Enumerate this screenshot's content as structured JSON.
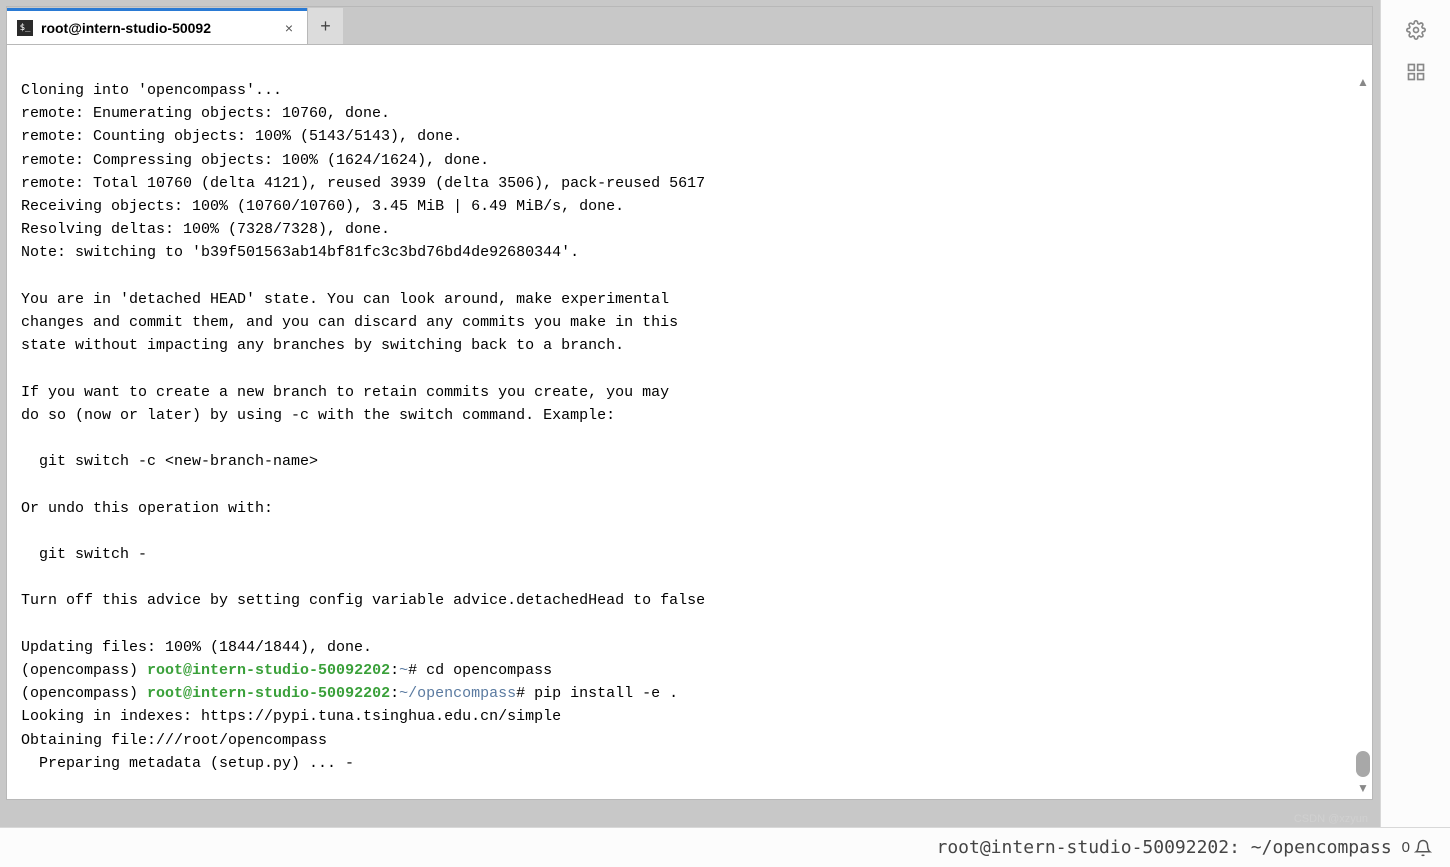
{
  "tab": {
    "title": "root@intern-studio-50092",
    "icon_glyph": "$_"
  },
  "terminal": {
    "lines": {
      "l0": "Cloning into 'opencompass'...",
      "l1": "remote: Enumerating objects: 10760, done.",
      "l2": "remote: Counting objects: 100% (5143/5143), done.",
      "l3": "remote: Compressing objects: 100% (1624/1624), done.",
      "l4": "remote: Total 10760 (delta 4121), reused 3939 (delta 3506), pack-reused 5617",
      "l5": "Receiving objects: 100% (10760/10760), 3.45 MiB | 6.49 MiB/s, done.",
      "l6": "Resolving deltas: 100% (7328/7328), done.",
      "l7": "Note: switching to 'b39f501563ab14bf81fc3c3bd76bd4de92680344'.",
      "l8": "",
      "l9": "You are in 'detached HEAD' state. You can look around, make experimental",
      "l10": "changes and commit them, and you can discard any commits you make in this",
      "l11": "state without impacting any branches by switching back to a branch.",
      "l12": "",
      "l13": "If you want to create a new branch to retain commits you create, you may",
      "l14": "do so (now or later) by using -c with the switch command. Example:",
      "l15": "",
      "l16": "  git switch -c <new-branch-name>",
      "l17": "",
      "l18": "Or undo this operation with:",
      "l19": "",
      "l20": "  git switch -",
      "l21": "",
      "l22": "Turn off this advice by setting config variable advice.detachedHead to false",
      "l23": "",
      "l24": "Updating files: 100% (1844/1844), done."
    },
    "prompt1": {
      "env": "(opencompass) ",
      "user": "root@intern-studio-50092202",
      "colon": ":",
      "path": "~",
      "pound": "# ",
      "cmd": "cd opencompass"
    },
    "prompt2": {
      "env": "(opencompass) ",
      "user": "root@intern-studio-50092202",
      "colon": ":",
      "path": "~/opencompass",
      "pound": "# ",
      "cmd": "pip install -e ."
    },
    "tail": {
      "t0": "Looking in indexes: https://pypi.tuna.tsinghua.edu.cn/simple",
      "t1": "Obtaining file:///root/opencompass",
      "t2": "  Preparing metadata (setup.py) ... -"
    }
  },
  "footer": {
    "text": "root@intern-studio-50092202: ~/opencompass",
    "badge": "0"
  },
  "watermark": "CSDN @xzyun"
}
